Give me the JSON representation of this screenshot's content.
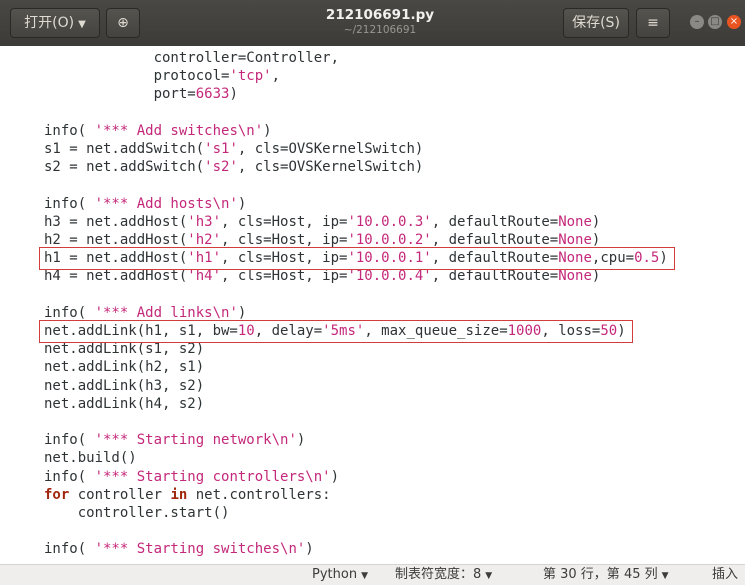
{
  "header": {
    "open_label": "打开(O)",
    "title": "212106691.py",
    "subtitle": "~/212106691",
    "save_label": "保存(S)",
    "menu_glyph": "≡",
    "new_tab_glyph": "⊕"
  },
  "code": [
    {
      "indent": 13,
      "tokens": [
        [
          "t",
          "controller=Controller,"
        ]
      ]
    },
    {
      "indent": 13,
      "tokens": [
        [
          "t",
          "protocol="
        ],
        [
          "s",
          "'tcp'"
        ],
        [
          "t",
          ","
        ]
      ]
    },
    {
      "indent": 13,
      "tokens": [
        [
          "t",
          "port="
        ],
        [
          "n",
          "6633"
        ],
        [
          "t",
          ")"
        ]
      ]
    },
    {
      "indent": 0,
      "tokens": []
    },
    {
      "indent": 0,
      "tokens": [
        [
          "t",
          "info( "
        ],
        [
          "s",
          "'*** Add switches\\n'"
        ],
        [
          "t",
          ")"
        ]
      ]
    },
    {
      "indent": 0,
      "tokens": [
        [
          "t",
          "s1 = net.addSwitch("
        ],
        [
          "s",
          "'s1'"
        ],
        [
          "t",
          ", cls=OVSKernelSwitch)"
        ]
      ]
    },
    {
      "indent": 0,
      "tokens": [
        [
          "t",
          "s2 = net.addSwitch("
        ],
        [
          "s",
          "'s2'"
        ],
        [
          "t",
          ", cls=OVSKernelSwitch)"
        ]
      ]
    },
    {
      "indent": 0,
      "tokens": []
    },
    {
      "indent": 0,
      "tokens": [
        [
          "t",
          "info( "
        ],
        [
          "s",
          "'*** Add hosts\\n'"
        ],
        [
          "t",
          ")"
        ]
      ]
    },
    {
      "indent": 0,
      "tokens": [
        [
          "t",
          "h3 = net.addHost("
        ],
        [
          "s",
          "'h3'"
        ],
        [
          "t",
          ", cls=Host, ip="
        ],
        [
          "s",
          "'10.0.0.3'"
        ],
        [
          "t",
          ", defaultRoute="
        ],
        [
          "n",
          "None"
        ],
        [
          "t",
          ")"
        ]
      ]
    },
    {
      "indent": 0,
      "tokens": [
        [
          "t",
          "h2 = net.addHost("
        ],
        [
          "s",
          "'h2'"
        ],
        [
          "t",
          ", cls=Host, ip="
        ],
        [
          "s",
          "'10.0.0.2'"
        ],
        [
          "t",
          ", defaultRoute="
        ],
        [
          "n",
          "None"
        ],
        [
          "t",
          ")"
        ]
      ]
    },
    {
      "indent": 0,
      "tokens": [
        [
          "t",
          "h1 = net.addHost("
        ],
        [
          "s",
          "'h1'"
        ],
        [
          "t",
          ", cls=Host, ip="
        ],
        [
          "s",
          "'10.0.0.1'"
        ],
        [
          "t",
          ", defaultRoute="
        ],
        [
          "n",
          "None"
        ],
        [
          "t",
          ",cpu="
        ],
        [
          "n",
          "0.5"
        ],
        [
          "t",
          ")"
        ]
      ]
    },
    {
      "indent": 0,
      "tokens": [
        [
          "t",
          "h4 = net.addHost("
        ],
        [
          "s",
          "'h4'"
        ],
        [
          "t",
          ", cls=Host, ip="
        ],
        [
          "s",
          "'10.0.0.4'"
        ],
        [
          "t",
          ", defaultRoute="
        ],
        [
          "n",
          "None"
        ],
        [
          "t",
          ")"
        ]
      ]
    },
    {
      "indent": 0,
      "tokens": []
    },
    {
      "indent": 0,
      "tokens": [
        [
          "t",
          "info( "
        ],
        [
          "s",
          "'*** Add links\\n'"
        ],
        [
          "t",
          ")"
        ]
      ]
    },
    {
      "indent": 0,
      "tokens": [
        [
          "t",
          "net.addLink(h1, s1, bw="
        ],
        [
          "n",
          "10"
        ],
        [
          "t",
          ", delay="
        ],
        [
          "s",
          "'5ms'"
        ],
        [
          "t",
          ", max_queue_size="
        ],
        [
          "n",
          "1000"
        ],
        [
          "t",
          ", loss="
        ],
        [
          "n",
          "50"
        ],
        [
          "t",
          ")"
        ]
      ]
    },
    {
      "indent": 0,
      "tokens": [
        [
          "t",
          "net.addLink(s1, s2)"
        ]
      ]
    },
    {
      "indent": 0,
      "tokens": [
        [
          "t",
          "net.addLink(h2, s1)"
        ]
      ]
    },
    {
      "indent": 0,
      "tokens": [
        [
          "t",
          "net.addLink(h3, s2)"
        ]
      ]
    },
    {
      "indent": 0,
      "tokens": [
        [
          "t",
          "net.addLink(h4, s2)"
        ]
      ]
    },
    {
      "indent": 0,
      "tokens": []
    },
    {
      "indent": 0,
      "tokens": [
        [
          "t",
          "info( "
        ],
        [
          "s",
          "'*** Starting network\\n'"
        ],
        [
          "t",
          ")"
        ]
      ]
    },
    {
      "indent": 0,
      "tokens": [
        [
          "t",
          "net.build()"
        ]
      ]
    },
    {
      "indent": 0,
      "tokens": [
        [
          "t",
          "info( "
        ],
        [
          "s",
          "'*** Starting controllers\\n'"
        ],
        [
          "t",
          ")"
        ]
      ]
    },
    {
      "indent": 0,
      "tokens": [
        [
          "k",
          "for"
        ],
        [
          "t",
          " controller "
        ],
        [
          "k",
          "in"
        ],
        [
          "t",
          " net.controllers:"
        ]
      ]
    },
    {
      "indent": 4,
      "tokens": [
        [
          "t",
          "controller.start()"
        ]
      ]
    },
    {
      "indent": 0,
      "tokens": []
    },
    {
      "indent": 0,
      "tokens": [
        [
          "t",
          "info( "
        ],
        [
          "s",
          "'*** Starting switches\\n'"
        ],
        [
          "t",
          ")"
        ]
      ]
    }
  ],
  "highlight_lines": [
    11,
    15
  ],
  "status": {
    "language": "Python",
    "tab_width": "制表符宽度：8",
    "position": "第 30 行，第 45 列",
    "mode": "插入"
  }
}
